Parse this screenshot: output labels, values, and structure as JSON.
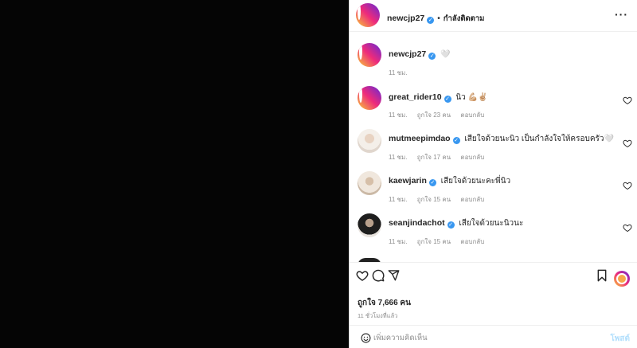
{
  "post": {
    "author": "newcjp27",
    "follow_status": "กำลังติดตาม",
    "caption_emoji": "🤍",
    "caption_time": "11 ชม.",
    "likes": "ถูกใจ 7,666 คน",
    "posted_ago": "11 ชั่วโมงที่แล้ว"
  },
  "comments": [
    {
      "username": "great_rider10",
      "text": "นิว 💪🏼✌🏼",
      "time": "11 ชม.",
      "likes": "ถูกใจ 23 คน",
      "reply": "ตอบกลับ"
    },
    {
      "username": "mutmeepimdao",
      "text": "เสียใจด้วยนะนิว เป็นกำลังใจให้ครอบครัว🤍",
      "time": "11 ชม.",
      "likes": "ถูกใจ 17 คน",
      "reply": "ตอบกลับ"
    },
    {
      "username": "kaewjarin",
      "text": "เสียใจด้วยนะคะพี่นิว",
      "time": "11 ชม.",
      "likes": "ถูกใจ 15 คน",
      "reply": "ตอบกลับ"
    },
    {
      "username": "seanjindachot",
      "text": "เสียใจด้วยนะนิวนะ",
      "time": "11 ชม.",
      "likes": "ถูกใจ 15 คน",
      "reply": "ตอบกลับ"
    }
  ],
  "composer": {
    "placeholder": "เพิ่มความคิดเห็น",
    "post_label": "โพสต์"
  },
  "colors": {
    "accent": "#3897f0",
    "muted": "#8e8e8e",
    "post_disabled": "#b2dffc"
  },
  "icons": [
    "more-icon",
    "verified-icon",
    "heart-icon",
    "comment-icon",
    "share-icon",
    "bookmark-icon",
    "smile-icon"
  ]
}
